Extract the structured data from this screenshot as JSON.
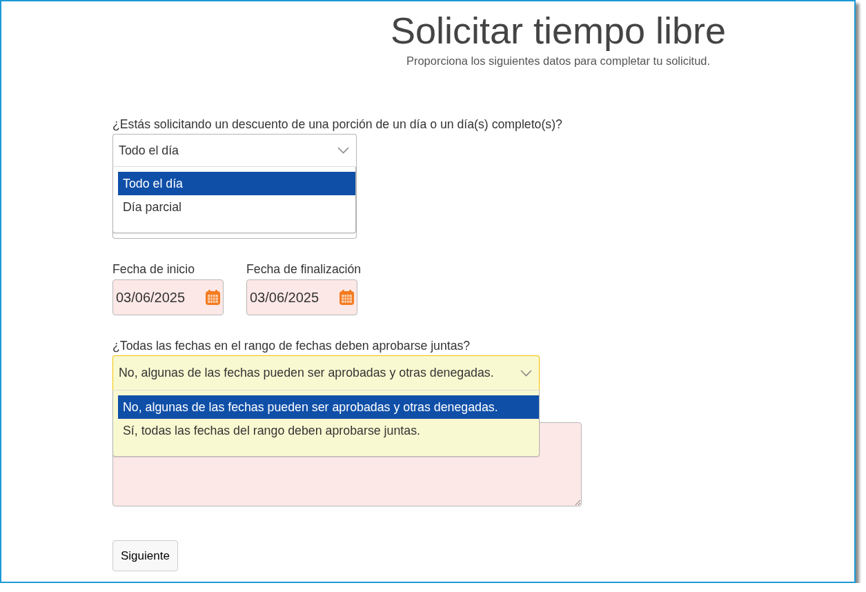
{
  "header": {
    "title": "Solicitar tiempo libre",
    "subtitle": "Proporciona los siguientes datos para completar tu solicitud."
  },
  "fields": [
    {
      "kind": "select",
      "label": "¿Estás solicitando un descuento de una porción de un día o un día(s) completo(s)?",
      "value": "Todo el día",
      "expanded": true,
      "focused": false,
      "options": [
        {
          "label": "Todo el día",
          "selected": true
        },
        {
          "label": "Día parcial",
          "selected": false
        }
      ]
    },
    {
      "kind": "dates",
      "items": [
        {
          "label": "Fecha de inicio",
          "value": "03/06/2025",
          "invalid": true
        },
        {
          "label": "Fecha de finalización",
          "value": "03/06/2025",
          "invalid": true
        }
      ]
    },
    {
      "kind": "select",
      "label": "¿Todas las fechas en el rango de fechas deben aprobarse juntas?",
      "value": "No, algunas de las fechas pueden ser aprobadas y otras denegadas.",
      "expanded": true,
      "focused": true,
      "options": [
        {
          "label": "No, algunas de las fechas pueden ser aprobadas y otras denegadas.",
          "selected": true
        },
        {
          "label": "Sí, todas las fechas del rango deben aprobarse juntas.",
          "selected": false
        }
      ]
    },
    {
      "kind": "textarea",
      "invalid": true
    }
  ],
  "submit_button": {
    "label": "Siguiente"
  }
}
